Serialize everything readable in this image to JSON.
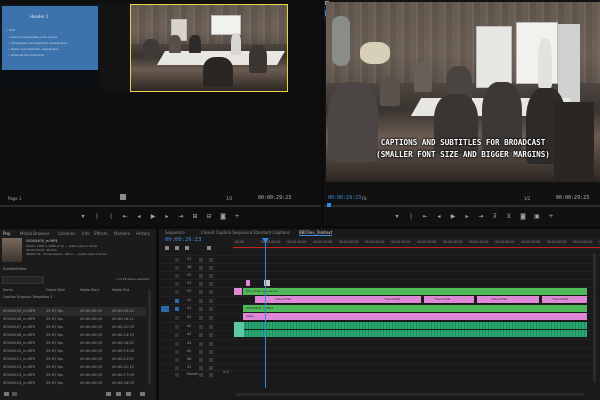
{
  "source_monitor": {
    "slide_title": "Header 1",
    "timecode": "00:00:29:23",
    "zoom": "1/2",
    "page_label": "Page 1",
    "slide_bullets": [
      "• Text",
      "• Sed ut perspiciatis unde omnis",
      "• Voluptatem accusantium doloremque",
      "• Totam rem aperiam, eaque ipsa",
      "• Quae ab illo inventore"
    ]
  },
  "program_monitor": {
    "caption_line1": "CAPTIONS AND SUBTITLES FOR BROADCAST",
    "caption_line2": "(SMALLER FONT SIZE AND BIGGER MARGINS)",
    "timecode": "00:00:29:23",
    "fit": "Fit",
    "zoom": "1/2",
    "duration": "00:00:29:23"
  },
  "project_panel": {
    "tabs": [
      "Proj",
      "Media Browser",
      "Libraries",
      "Info",
      "Effects",
      "Markers",
      "History"
    ],
    "clip_name": "00000405_m.MP4",
    "clip_meta": [
      "Movie, 1920 x 1080 (1.0) — video used 2 times",
      "00:00:29:23, 29.97p",
      "48000 Hz - Compressed - Mono — audio used 2 times"
    ],
    "project_name": "SubtitleEditor",
    "items_selected": "1 of 22 items selected",
    "bin_label": "Caption Graphics Templates 3",
    "columns": [
      "Name",
      "Frame Rate",
      "Media Start",
      "Media End"
    ],
    "rows": [
      {
        "name": "00000405_m.MP4",
        "fps": "29.97 fps",
        "start": "00:00:00:00",
        "end": "00:00:29:22"
      },
      {
        "name": "00000406_m.MP4",
        "fps": "29.97 fps",
        "start": "00:00:00:00",
        "end": "00:00:18:12"
      },
      {
        "name": "00000407_m.MP4",
        "fps": "29.97 fps",
        "start": "00:00:00:00",
        "end": "00:00:21:05"
      },
      {
        "name": "00000408_m.MP4",
        "fps": "29.97 fps",
        "start": "00:00:00:00",
        "end": "00:00:14:19"
      },
      {
        "name": "00000409_m.MP4",
        "fps": "29.97 fps",
        "start": "00:00:00:00",
        "end": "00:00:26:02"
      },
      {
        "name": "00000410_m.MP4",
        "fps": "29.97 fps",
        "start": "00:00:00:00",
        "end": "00:00:19:28"
      },
      {
        "name": "00000411_m.MP4",
        "fps": "29.97 fps",
        "start": "00:00:00:00",
        "end": "00:00:11:07"
      },
      {
        "name": "00000412_m.MP4",
        "fps": "29.97 fps",
        "start": "00:00:00:00",
        "end": "00:00:22:15"
      },
      {
        "name": "00000413_m.MP4",
        "fps": "29.97 fps",
        "start": "00:00:00:00",
        "end": "00:00:17:09"
      },
      {
        "name": "00000414_m.MP4",
        "fps": "29.97 fps",
        "start": "00:00:00:00",
        "end": "00:00:24:03"
      }
    ]
  },
  "timeline": {
    "tabs": [
      "Sequence",
      "Closed Caption Sequence",
      "Standard Captions",
      "BBCRev_Teletext"
    ],
    "timecode": "00:00:29:23",
    "ruler": [
      "00:00",
      "00:00:05:00",
      "00:00:10:00",
      "00:00:15:00",
      "00:00:20:00",
      "00:00:25:00",
      "00:00:30:00",
      "00:00:35:00",
      "00:00:40:00",
      "00:00:45:00",
      "00:00:50:00",
      "00:00:55:00",
      "00:01:00:00",
      "00:01:05:00",
      "00:01:10:00"
    ],
    "track_names": [
      "V7",
      "V6",
      "V5",
      "V4",
      "V3",
      "V2",
      "V1",
      "A1",
      "A2",
      "A3",
      "A4",
      "A5",
      "A6",
      "A7",
      "Master"
    ],
    "clip_labels": {
      "subtitle_track": "RFL_Video processed",
      "title_clips": [
        "Theo1.PSD",
        "Theo1.PSD",
        "Theo1.PSD",
        "Theo1.PSD",
        "Theo1.PSD"
      ],
      "video_track": "00000405_m.MP4",
      "caption_track": "Sway"
    },
    "master_value": "0.0"
  },
  "colors": {
    "accent_blue": "#2d8ceb",
    "selected_yellow": "#e8d34a",
    "green_clip": "#4fb858",
    "pink_clip": "#e088d8",
    "teal_audio": "#2aa874"
  }
}
